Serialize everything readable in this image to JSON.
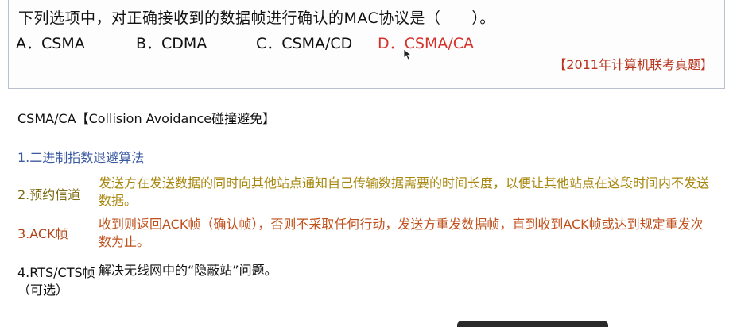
{
  "question": {
    "text": "下列选项中，对正确接收到的数据帧进行确认的MAC协议是（　　）。",
    "options": {
      "a": "A．CSMA",
      "b": "B．CDMA",
      "c": "C．CSMA/CD",
      "d": "D．CSMA/CA"
    },
    "source": "【2011年计算机联考真题】",
    "answer_color": "#d6322c"
  },
  "notes": {
    "heading": "CSMA/CA【Collision Avoidance碰撞避免】",
    "items": [
      {
        "label": "1.二进制指数退避算法",
        "desc": ""
      },
      {
        "label": "2.预约信道",
        "desc": "发送方在发送数据的同时向其他站点通知自己传输数据需要的时间长度，以便让其他站点在这段时间内不发送数据。"
      },
      {
        "label": "3.ACK帧",
        "desc": "收到则返回ACK帧（确认帧），否则不采取任何行动，发送方重发数据帧，直到收到ACK帧或达到规定重发次数为止。"
      },
      {
        "label": "4.RTS/CTS帧",
        "desc": "解决无线网中的“隐蔽站”问题。",
        "sub": "（可选）"
      }
    ]
  }
}
